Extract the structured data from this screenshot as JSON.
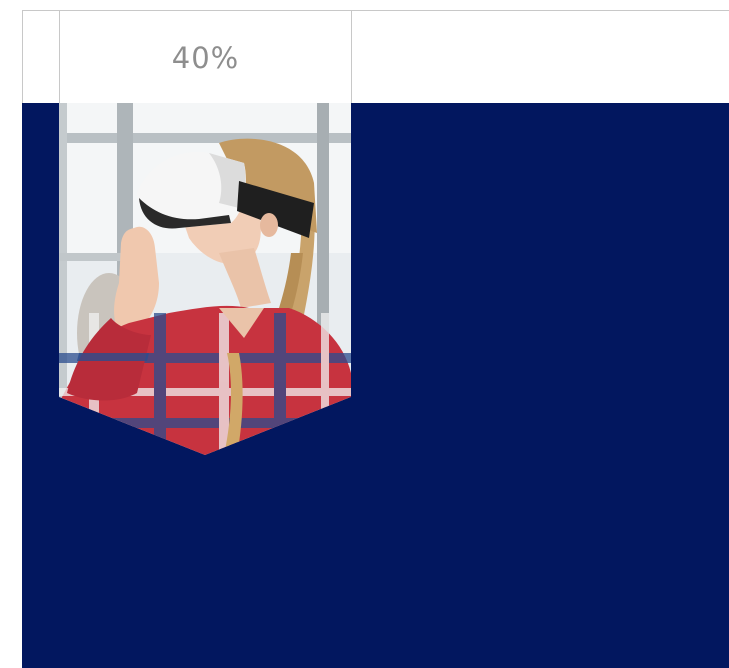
{
  "stat": {
    "value": "40%"
  },
  "image": {
    "subject": "vr-headset-girl-photo"
  },
  "colors": {
    "panel": "#02175f",
    "stat_text": "#8e8e8e",
    "grid_line": "#c8c8c8"
  }
}
